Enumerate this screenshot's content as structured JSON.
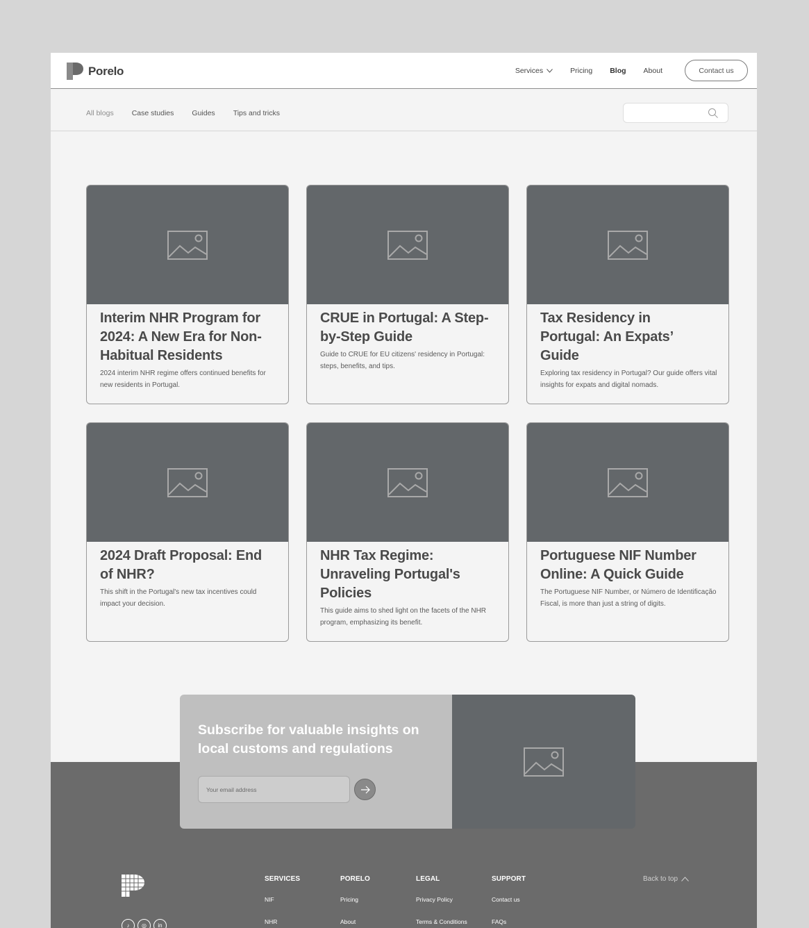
{
  "brand": {
    "name": "Porelo"
  },
  "nav": {
    "services": "Services",
    "pricing": "Pricing",
    "blog": "Blog",
    "about": "About",
    "contact": "Contact us"
  },
  "subnav": {
    "links": [
      "All blogs",
      "Case studies",
      "Guides",
      "Tips and tricks"
    ],
    "search_placeholder": ""
  },
  "posts": [
    {
      "title": "Interim NHR Program for 2024: A New Era for Non-Habitual Residents",
      "desc": "2024 interim NHR regime offers continued benefits for new residents in Portugal."
    },
    {
      "title": "CRUE in Portugal: A Step-by-Step Guide",
      "desc": "Guide to CRUE for EU citizens' residency in Portugal: steps, benefits, and tips."
    },
    {
      "title": "Tax Residency in Portugal: An Expats’ Guide",
      "desc": "Exploring tax residency in Portugal? Our guide offers vital insights for expats and digital nomads."
    },
    {
      "title": "2024 Draft Proposal: End of NHR?",
      "desc": "This shift in the Portugal's new tax incentives could impact your decision."
    },
    {
      "title": "NHR Tax Regime: Unraveling Portugal's Policies",
      "desc": "This guide aims to shed light on the facets of the NHR program, emphasizing its benefit."
    },
    {
      "title": "Portuguese NIF Number Online: A Quick Guide",
      "desc": "The Portuguese NIF Number, or Número de Identificação Fiscal, is more than just a string of digits."
    }
  ],
  "subscribe": {
    "title": "Subscribe for valuable insights on local customs and regulations",
    "email_placeholder": "Your email address"
  },
  "footer": {
    "columns": [
      {
        "heading": "SERVICES",
        "links": [
          "NIF",
          "NHR"
        ]
      },
      {
        "heading": "PORELO",
        "links": [
          "Pricing",
          "About"
        ]
      },
      {
        "heading": "LEGAL",
        "links": [
          "Privacy Policy",
          "Terms & Conditions"
        ]
      },
      {
        "heading": "SUPPORT",
        "links": [
          "Contact us",
          "FAQs"
        ]
      }
    ],
    "back_to_top": "Back to top",
    "socials": [
      "tiktok-icon",
      "instagram-icon",
      "linkedin-icon"
    ]
  }
}
